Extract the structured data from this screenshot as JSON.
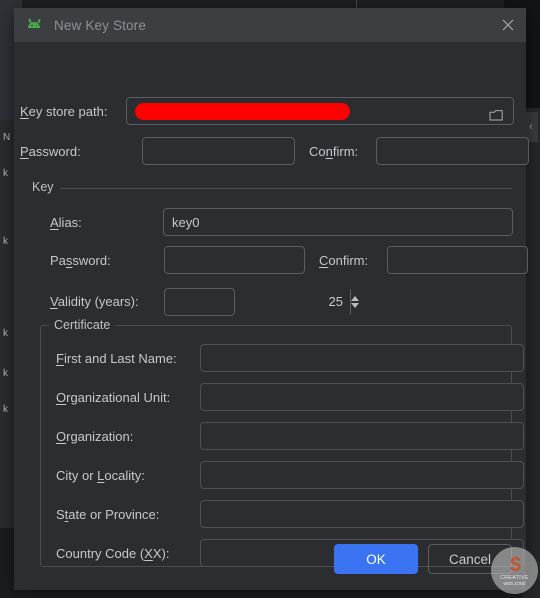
{
  "background": {
    "tree_fragments": [
      "N",
      "k",
      "k",
      "k",
      "k",
      "k"
    ],
    "collapse_chevron": "‹"
  },
  "dialog": {
    "title": "New Key Store",
    "app_icon": "android-robot-icon",
    "close_icon": "close-icon"
  },
  "keystore": {
    "path_label": "Key store path:",
    "path_label_mnemonic": "K",
    "path_value": "",
    "path_redacted": true,
    "browse_icon": "folder-icon",
    "password_label": "Password:",
    "password_label_mnemonic": "P",
    "password_value": "",
    "confirm_label": "Confirm:",
    "confirm_label_mnemonic": "n",
    "confirm_value": ""
  },
  "key_group": {
    "title": "Key",
    "alias_label": "Alias:",
    "alias_label_mnemonic": "A",
    "alias_value": "key0",
    "password_label": "Password:",
    "password_label_mnemonic": "s",
    "password_value": "",
    "confirm_label": "Confirm:",
    "confirm_label_mnemonic": "C",
    "confirm_value": "",
    "validity_label": "Validity (years):",
    "validity_label_mnemonic": "V",
    "validity_value": "25"
  },
  "certificate": {
    "title": "Certificate",
    "fields": [
      {
        "label": "First and Last Name:",
        "mnemonic": "F",
        "value": ""
      },
      {
        "label": "Organizational Unit:",
        "mnemonic": "O",
        "value": ""
      },
      {
        "label": "Organization:",
        "mnemonic": "O",
        "value": ""
      },
      {
        "label": "City or Locality:",
        "mnemonic": "L",
        "value": ""
      },
      {
        "label": "State or Province:",
        "mnemonic": "t",
        "value": ""
      },
      {
        "label": "Country Code (XX):",
        "mnemonic": "X",
        "value": ""
      }
    ]
  },
  "footer": {
    "ok_label": "OK",
    "cancel_label": "Cancel"
  },
  "watermark": {
    "mark": "S",
    "name": "CREATIVE",
    "sub": "WEB ZONE"
  },
  "colors": {
    "accent": "#3b74f2",
    "redaction": "#fe0000",
    "dialog_bg": "#2b2d30",
    "titlebar_bg": "#3c3f41",
    "android_green": "#4ba84b"
  }
}
